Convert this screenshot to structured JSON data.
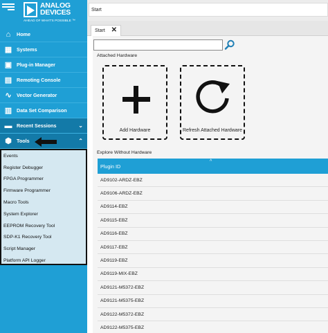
{
  "sidebar": {
    "logo": {
      "line1": "ANALOG",
      "line2": "DEVICES",
      "tagline": "AHEAD OF WHAT'S POSSIBLE ™"
    },
    "items": [
      {
        "label": "Home",
        "icon": "home-icon"
      },
      {
        "label": "Systems",
        "icon": "systems-icon"
      },
      {
        "label": "Plug-in Manager",
        "icon": "plugin-icon"
      },
      {
        "label": "Remoting Console",
        "icon": "remote-console-icon"
      },
      {
        "label": "Vector Generator",
        "icon": "vector-generator-icon"
      },
      {
        "label": "Data Set Comparison",
        "icon": "dataset-icon"
      },
      {
        "label": "Recent Sessions",
        "icon": "folder-icon",
        "chevron": "⌄"
      },
      {
        "label": "Tools",
        "icon": "tools-icon",
        "chevron": "⌃"
      }
    ],
    "tools": [
      "Events",
      "Register Debugger",
      "FPGA Programmer",
      "Firmware Programmer",
      "Macro Tools",
      "System Explorer",
      "EEPROM Recovery Tool",
      "SDP-K1 Recovery Tool",
      "Script Manager",
      "Platform API Logger"
    ]
  },
  "header": {
    "breadcrumb": "Start"
  },
  "tabs": [
    {
      "label": "Start",
      "close": "✕"
    }
  ],
  "main": {
    "search": {
      "value": "",
      "placeholder": ""
    },
    "attached_label": "Attached Hardware",
    "add_hardware_label": "Add Hardware",
    "refresh_hardware_label": "Refresh Attached Hardware",
    "explore_label": "Explore Without Hardware",
    "table": {
      "header": "Plugin ID",
      "sort_indicator": "^",
      "rows": [
        "AD9102-ARDZ-EBZ",
        "AD9106-ARDZ-EBZ",
        "AD9114-EBZ",
        "AD9115-EBZ",
        "AD9116-EBZ",
        "AD9117-EBZ",
        "AD9119-EBZ",
        "AD9119-MIX-EBZ",
        "AD9121-M5372-EBZ",
        "AD9121-M5375-EBZ",
        "AD9122-M5372-EBZ",
        "AD9122-M5375-EBZ"
      ]
    }
  },
  "colors": {
    "accent": "#1f9fd5",
    "sidebar_dark": "#137aa8",
    "tools_panel": "#d5e8f1"
  }
}
